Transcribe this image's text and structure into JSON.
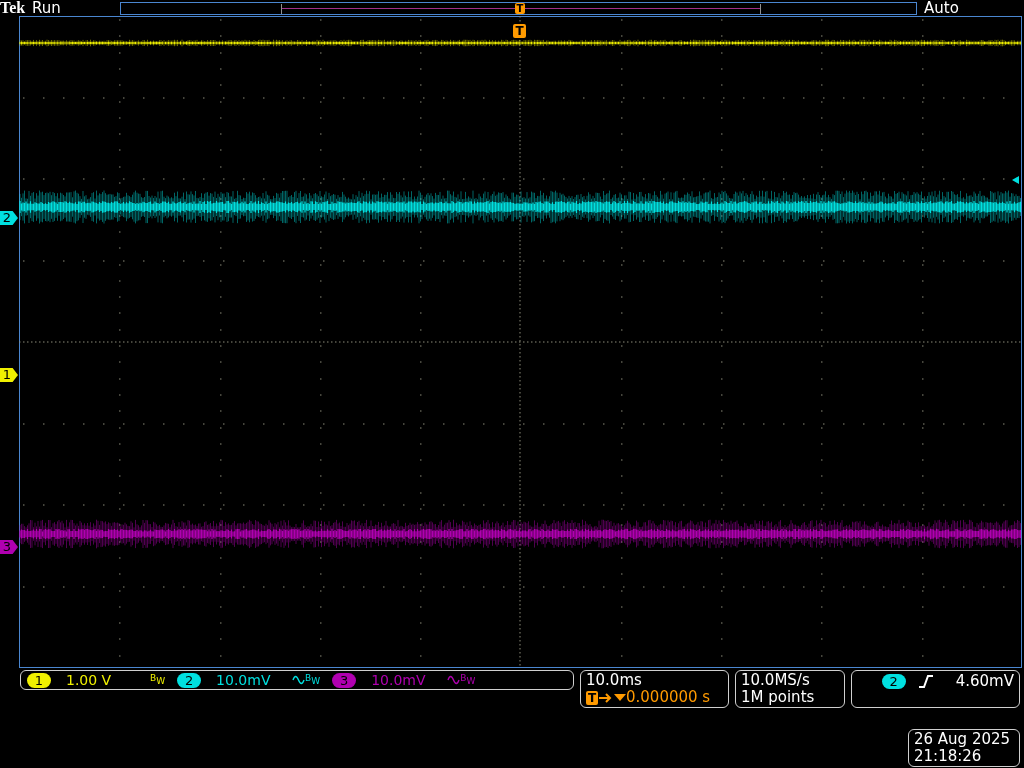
{
  "header": {
    "brand": "Tek",
    "acquisition_state": "Run",
    "record_trigger_marker": "T",
    "trigger_mode": "Auto"
  },
  "graticule": {
    "trigger_marker": "T"
  },
  "channel_markers": [
    {
      "number": "2",
      "color": "#00e0e0"
    },
    {
      "number": "1",
      "color": "#f0f000"
    },
    {
      "number": "3",
      "color": "#b000b0"
    }
  ],
  "channels": [
    {
      "number": "1",
      "color": "#f0f000",
      "scale": "1.00 V",
      "kind": "dc",
      "bandwidth_limit": "B$_{W}$"
    },
    {
      "number": "2",
      "color": "#00e0e0",
      "scale": "10.0mV",
      "kind": "ac",
      "bandwidth_limit": "B$_{W}$"
    },
    {
      "number": "3",
      "color": "#b000b0",
      "scale": "10.0mV",
      "kind": "ac",
      "bandwidth_limit": "B$_{W}$"
    }
  ],
  "timebase": {
    "scale": "10.0ms",
    "trigger_marker": "T",
    "position": "0.000000 s"
  },
  "acquisition": {
    "sample_rate": "10.0MS/s",
    "record_length": "1M points"
  },
  "trigger": {
    "source": "2",
    "level": "4.60mV"
  },
  "clock": {
    "date": "26 Aug 2025",
    "time": "21:18:26"
  }
}
